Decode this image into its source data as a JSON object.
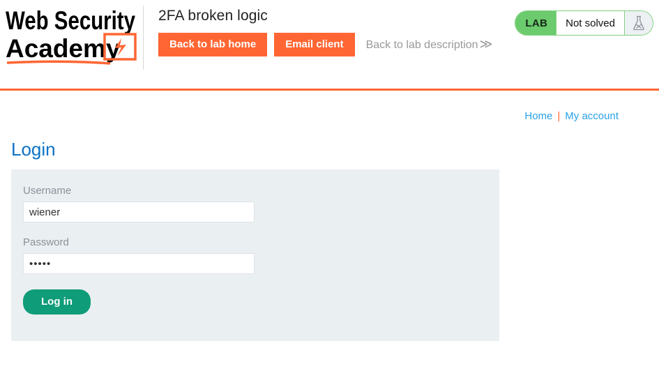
{
  "header": {
    "logo_line1": "Web Security",
    "logo_line2": "Academy",
    "lab_title": "2FA broken logic",
    "back_to_lab_home": "Back to lab home",
    "email_client": "Email client",
    "back_to_lab_description": "Back to lab description",
    "back_to_lab_description_chevron": "≫"
  },
  "lab_status": {
    "tag": "LAB",
    "status": "Not solved",
    "icon": "flask-not-solved-icon",
    "tag_bg_color": "#6ccb6c",
    "border_color": "#7ed07e"
  },
  "nav": {
    "home": "Home",
    "separator": "|",
    "my_account": "My account"
  },
  "main": {
    "page_title": "Login",
    "username_label": "Username",
    "username_value": "wiener",
    "password_label": "Password",
    "password_value": "•••••",
    "login_button": "Log in"
  },
  "colors": {
    "brand_orange": "#ff6633",
    "link_blue": "#29a1e8",
    "title_blue": "#0d72c4",
    "panel_bg": "#eaeff1",
    "button_teal": "#0f9c79"
  }
}
